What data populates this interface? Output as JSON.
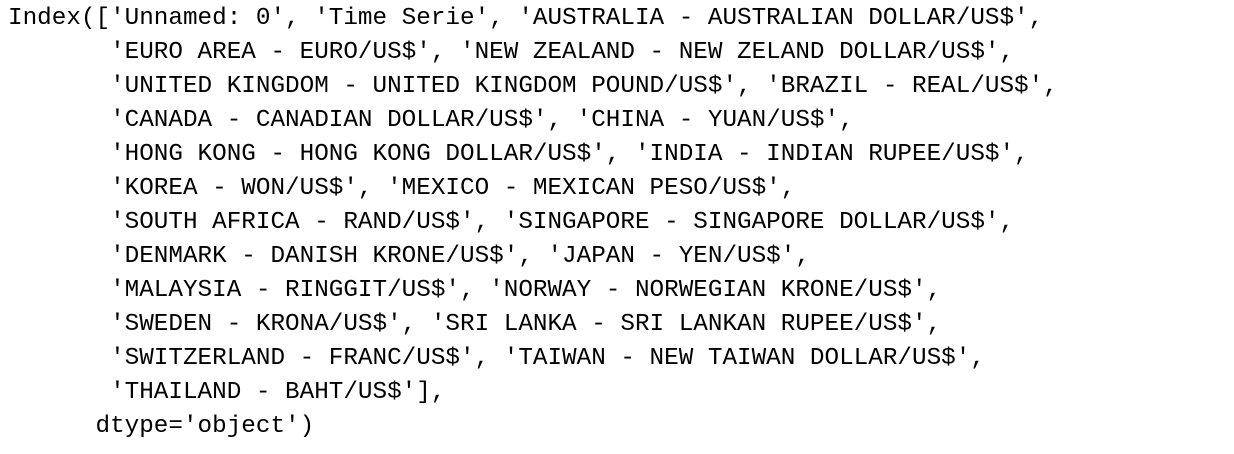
{
  "output": {
    "lines": [
      "Index(['Unnamed: 0', 'Time Serie', 'AUSTRALIA - AUSTRALIAN DOLLAR/US$',",
      "       'EURO AREA - EURO/US$', 'NEW ZEALAND - NEW ZELAND DOLLAR/US$',",
      "       'UNITED KINGDOM - UNITED KINGDOM POUND/US$', 'BRAZIL - REAL/US$',",
      "       'CANADA - CANADIAN DOLLAR/US$', 'CHINA - YUAN/US$',",
      "       'HONG KONG - HONG KONG DOLLAR/US$', 'INDIA - INDIAN RUPEE/US$',",
      "       'KOREA - WON/US$', 'MEXICO - MEXICAN PESO/US$',",
      "       'SOUTH AFRICA - RAND/US$', 'SINGAPORE - SINGAPORE DOLLAR/US$',",
      "       'DENMARK - DANISH KRONE/US$', 'JAPAN - YEN/US$',",
      "       'MALAYSIA - RINGGIT/US$', 'NORWAY - NORWEGIAN KRONE/US$',",
      "       'SWEDEN - KRONA/US$', 'SRI LANKA - SRI LANKAN RUPEE/US$',",
      "       'SWITZERLAND - FRANC/US$', 'TAIWAN - NEW TAIWAN DOLLAR/US$',",
      "       'THAILAND - BAHT/US$'],",
      "      dtype='object')"
    ]
  }
}
